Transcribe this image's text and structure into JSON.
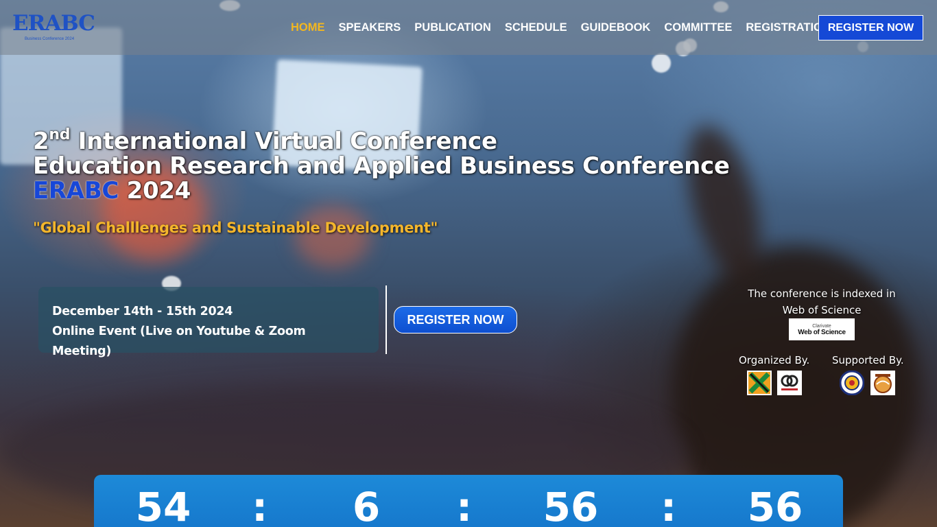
{
  "nav": {
    "logo_text": "ERABC",
    "logo_subtext": "Business Conference 2024",
    "items": [
      {
        "label": "HOME",
        "active": true
      },
      {
        "label": "SPEAKERS",
        "active": false
      },
      {
        "label": "PUBLICATION",
        "active": false
      },
      {
        "label": "SCHEDULE",
        "active": false
      },
      {
        "label": "GUIDEBOOK",
        "active": false
      },
      {
        "label": "COMMITTEE",
        "active": false
      },
      {
        "label": "REGISTRATION",
        "active": false
      }
    ],
    "cta_label": "REGISTER NOW"
  },
  "hero": {
    "ordinal_number": "2",
    "ordinal_suffix": "nd",
    "title_line1": "International Virtual Conference",
    "title_line2": "Education Research and Applied Business Conference",
    "brand": "ERABC",
    "year": "2024",
    "tagline": "\"Global Challlenges and Sustainable Development\"",
    "date": "December 14th - 15th 2024",
    "location": "Online Event (Live on Youtube & Zoom Meeting)",
    "cta_label": "REGISTER NOW"
  },
  "side": {
    "indexed_line1": "The conference is indexed in",
    "indexed_line2": "Web of Science",
    "wos_badge_top": "Clarivate",
    "wos_badge_main": "Web of Science",
    "organized_label": "Organized By.",
    "supported_label": "Supported By."
  },
  "countdown": {
    "days": "54",
    "hours": "6",
    "minutes": "56",
    "seconds": "56",
    "separator": ":"
  },
  "colors": {
    "accent_yellow": "#f2b71f",
    "brand_blue": "#1549d6",
    "countdown_blue": "#1d8ad8"
  }
}
